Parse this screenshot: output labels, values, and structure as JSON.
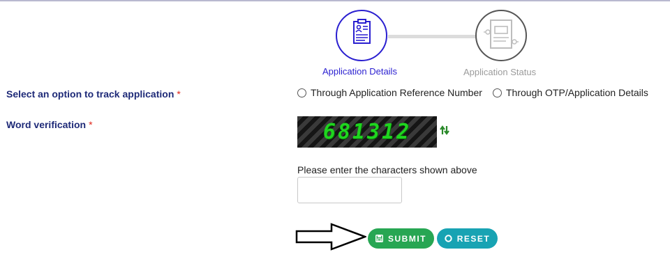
{
  "stepper": {
    "steps": [
      {
        "label": "Application Details",
        "icon": "application-form-icon",
        "status": "active",
        "color": "#2a1fd0"
      },
      {
        "label": "Application Status",
        "icon": "status-document-icon",
        "status": "inactive",
        "color": "#9b9b9b"
      }
    ]
  },
  "track_option": {
    "label": "Select an option to track application",
    "required_marker": "*",
    "options": [
      {
        "label": "Through Application Reference Number",
        "selected": false
      },
      {
        "label": "Through OTP/Application Details",
        "selected": false
      }
    ]
  },
  "word_verification": {
    "label": "Word verification",
    "required_marker": "*",
    "captcha_text": "681312",
    "refresh_icon": "refresh-icon",
    "prompt": "Please enter the characters shown above",
    "input_value": "",
    "input_placeholder": ""
  },
  "buttons": {
    "submit_label": "SUBMIT",
    "reset_label": "RESET",
    "submit_color": "#27a653",
    "reset_color": "#18a3b3"
  },
  "colors": {
    "label_text": "#1e2a78",
    "required": "#e0261b"
  }
}
